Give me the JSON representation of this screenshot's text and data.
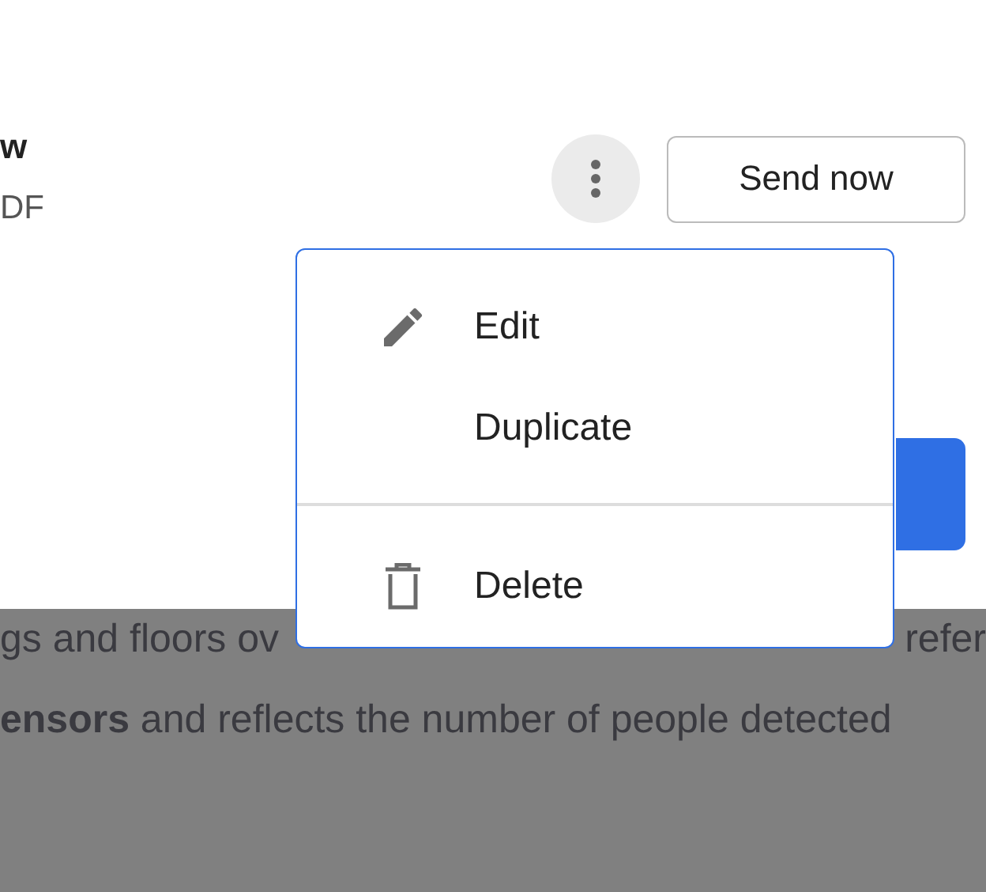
{
  "header": {
    "title": "w",
    "subtitle": "DF"
  },
  "actions": {
    "send_button": "Send now"
  },
  "menu": {
    "items": [
      {
        "label": "Edit",
        "kind": "edit"
      },
      {
        "label": "Duplicate",
        "kind": "plain"
      },
      {
        "kind": "divider"
      },
      {
        "label": "Delete",
        "kind": "delete"
      }
    ]
  },
  "background_text": {
    "line_1_left": "gs and floors ov",
    "line_1_right": "refer",
    "line_2": "**ensors** and reflects the number of people detected"
  }
}
